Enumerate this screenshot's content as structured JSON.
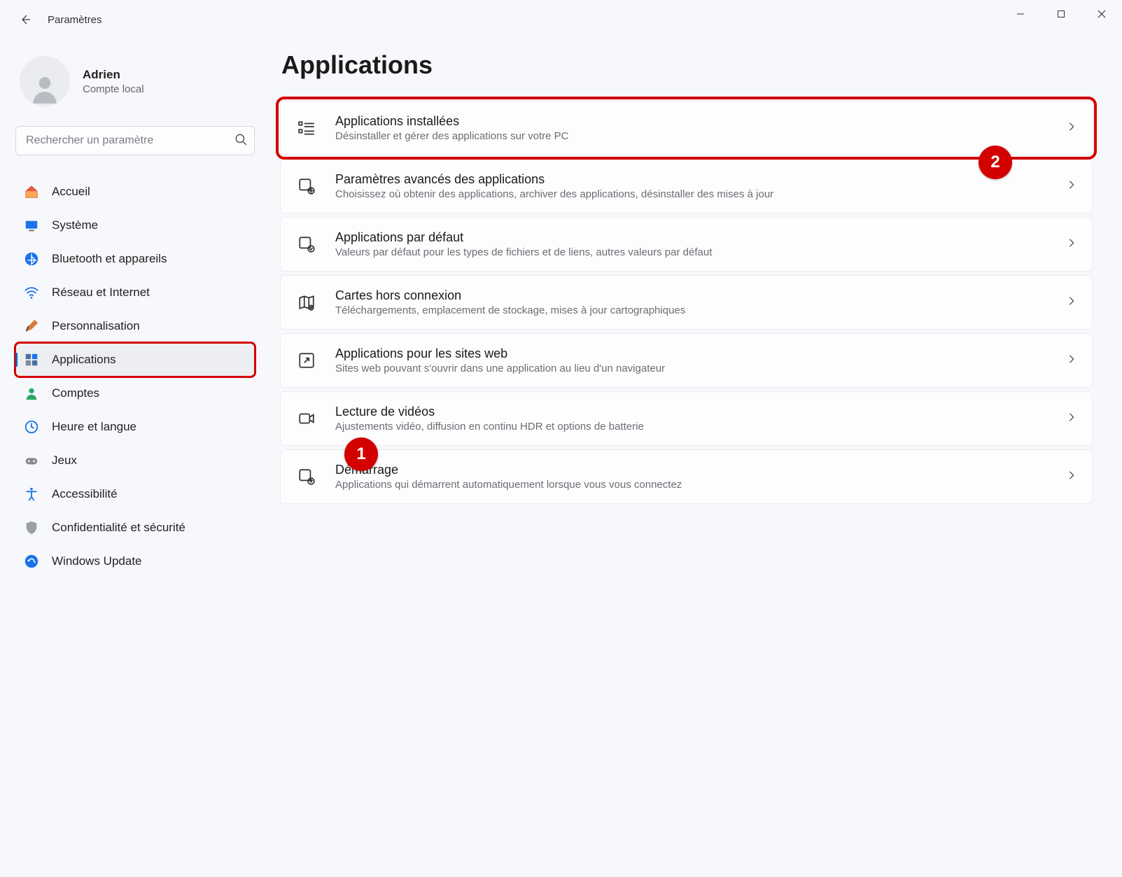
{
  "window": {
    "title": "Paramètres"
  },
  "profile": {
    "name": "Adrien",
    "subtitle": "Compte local"
  },
  "search": {
    "placeholder": "Rechercher un paramètre"
  },
  "sidebar": {
    "items": [
      {
        "id": "home",
        "label": "Accueil"
      },
      {
        "id": "system",
        "label": "Système"
      },
      {
        "id": "bluetooth",
        "label": "Bluetooth et appareils"
      },
      {
        "id": "network",
        "label": "Réseau et Internet"
      },
      {
        "id": "personal",
        "label": "Personnalisation"
      },
      {
        "id": "apps",
        "label": "Applications",
        "active": true
      },
      {
        "id": "accounts",
        "label": "Comptes"
      },
      {
        "id": "time",
        "label": "Heure et langue"
      },
      {
        "id": "gaming",
        "label": "Jeux"
      },
      {
        "id": "access",
        "label": "Accessibilité"
      },
      {
        "id": "privacy",
        "label": "Confidentialité et sécurité"
      },
      {
        "id": "update",
        "label": "Windows Update"
      }
    ]
  },
  "main": {
    "title": "Applications",
    "cards": [
      {
        "title": "Applications installées",
        "desc": "Désinstaller et gérer des applications sur votre PC"
      },
      {
        "title": "Paramètres avancés des applications",
        "desc": "Choisissez où obtenir des applications, archiver des applications, désinstaller des mises à jour"
      },
      {
        "title": "Applications par défaut",
        "desc": "Valeurs par défaut pour les types de fichiers et de liens, autres valeurs par défaut"
      },
      {
        "title": "Cartes hors connexion",
        "desc": "Téléchargements, emplacement de stockage, mises à jour cartographiques"
      },
      {
        "title": "Applications pour les sites web",
        "desc": "Sites web pouvant s'ouvrir dans une application au lieu d'un navigateur"
      },
      {
        "title": "Lecture de vidéos",
        "desc": "Ajustements vidéo, diffusion en continu HDR et options de batterie"
      },
      {
        "title": "Démarrage",
        "desc": "Applications qui démarrent automatiquement lorsque vous vous connectez"
      }
    ]
  },
  "annotations": [
    {
      "n": "1"
    },
    {
      "n": "2"
    }
  ]
}
